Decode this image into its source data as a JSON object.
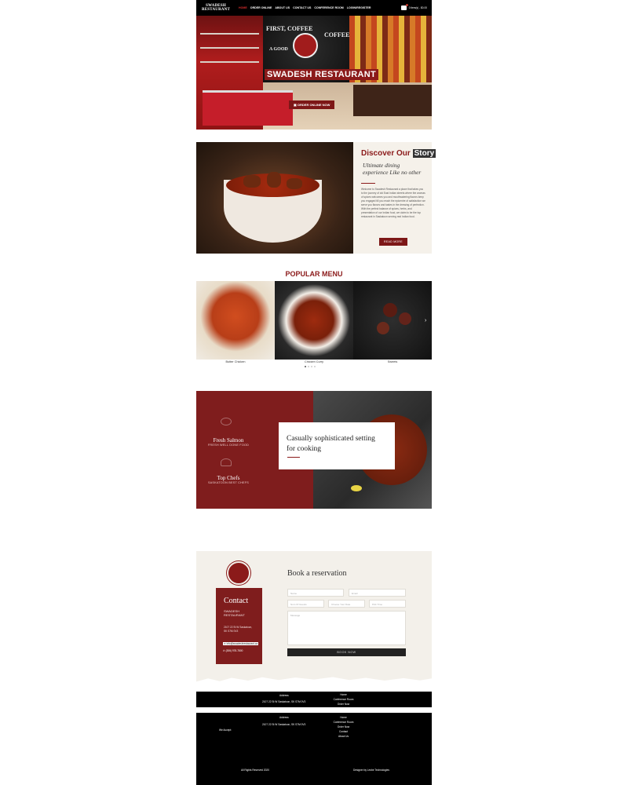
{
  "nav": {
    "logo_line1": "SWADESH",
    "logo_line2": "RESTAURANT",
    "links": [
      "HOME",
      "ORDER ONLINE",
      "ABOUT US",
      "CONTACT US",
      "CONFERENCE ROOM",
      "LOGIN/REGISTER"
    ],
    "active_link": "HOME",
    "cart_text": "0 item(s) - $0.00"
  },
  "hero": {
    "title": "SWADESH RESTAURANT",
    "button": "ORDER ONLINE NOW",
    "mural_words": [
      "FIRST, COFFEE",
      "COFFEE",
      "A GOOD"
    ]
  },
  "story": {
    "title_plain": "Discover Our",
    "title_highlight": "Story",
    "subtitle": "Ultimate dining experience Like no other",
    "body": "Welcome to Swadesh Restaurant a place that takes you to the journey of old East Indian streets where the aromas of spices welcomes you and mouthwatering flavors keep you engaged till you reach the epicentre of satisfaction we serve you flavors and tastes in the dressing of perfection. With the perfect balance of spices, herbs, and presentation of our Indian food, we claim to be the top restaurant in Saskatoon serving real Indian food.",
    "button": "READ MORE"
  },
  "popular_menu": {
    "title": "POPULAR MENU",
    "items": [
      {
        "name": "Butter Chicken"
      },
      {
        "name": "Chicken Curry"
      },
      {
        "name": "Sweets"
      }
    ]
  },
  "feature": {
    "items": [
      {
        "title": "Fresh Salmon",
        "subtitle": "FRESH WELL DONE FOOD"
      },
      {
        "title": "Top Chefs",
        "subtitle": "SASKATOON BEST CHEFS"
      }
    ],
    "card_text": "Casually sophisticated setting for cooking"
  },
  "reservation": {
    "contact_title": "Contact",
    "contact_name": "SWADESH RESTAURANT",
    "address": "2107 22 St W Saskatoon, SK S7M 0V3",
    "email": "info@swadeshrestaurant.ca",
    "phone": "(306) 978-7800",
    "form_title": "Book a reservation",
    "fields": {
      "name": "Name",
      "email": "Email",
      "num_guests": "Num Of Guests",
      "date": "Choose Your Date",
      "time": "Pick Time",
      "message": "Message"
    },
    "button": "BOOK NOW"
  },
  "footer": {
    "address_label": "Address",
    "address": "2107 22 St W Saskatoon, SK S7M 0V3",
    "links": [
      "Home",
      "Conference Room",
      "Order Now",
      "Contact",
      "About Us"
    ],
    "we_accept": "We Accept:",
    "copyright": "All Rights Reserved 2020",
    "designer": "Designer by Leshe Technologies"
  }
}
